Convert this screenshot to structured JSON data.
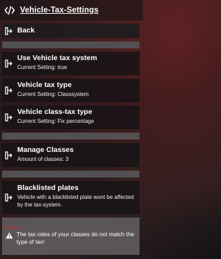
{
  "menu": {
    "title": "Vehicle-Tax-Settings",
    "items": [
      {
        "label": "Back",
        "sub": ""
      },
      {
        "label": "Use Vehicle tax system",
        "sub": "Current Setting: true"
      },
      {
        "label": "Vehicle tax type",
        "sub": "Current Setting: Classsystem"
      },
      {
        "label": "Vehicle class-tax type",
        "sub": "Current Setting: Fix percentage"
      },
      {
        "label": "Manage Classes",
        "sub": "Amount of classes: 3"
      },
      {
        "label": "Blacklisted plates",
        "sub": "Vehicle with a blacklisted plate wont be affected by the tax-system."
      }
    ],
    "error": {
      "title": "Error!",
      "message": "The tax rates of your classes do not match the type of tax!"
    }
  },
  "colors": {
    "separator": "#525052",
    "error_title": "#c22a2a",
    "error_background": "#5a5658"
  },
  "icons": {
    "header": "code-icon",
    "item": "enter-arrow-icon",
    "warning": "warning-triangle-icon"
  }
}
